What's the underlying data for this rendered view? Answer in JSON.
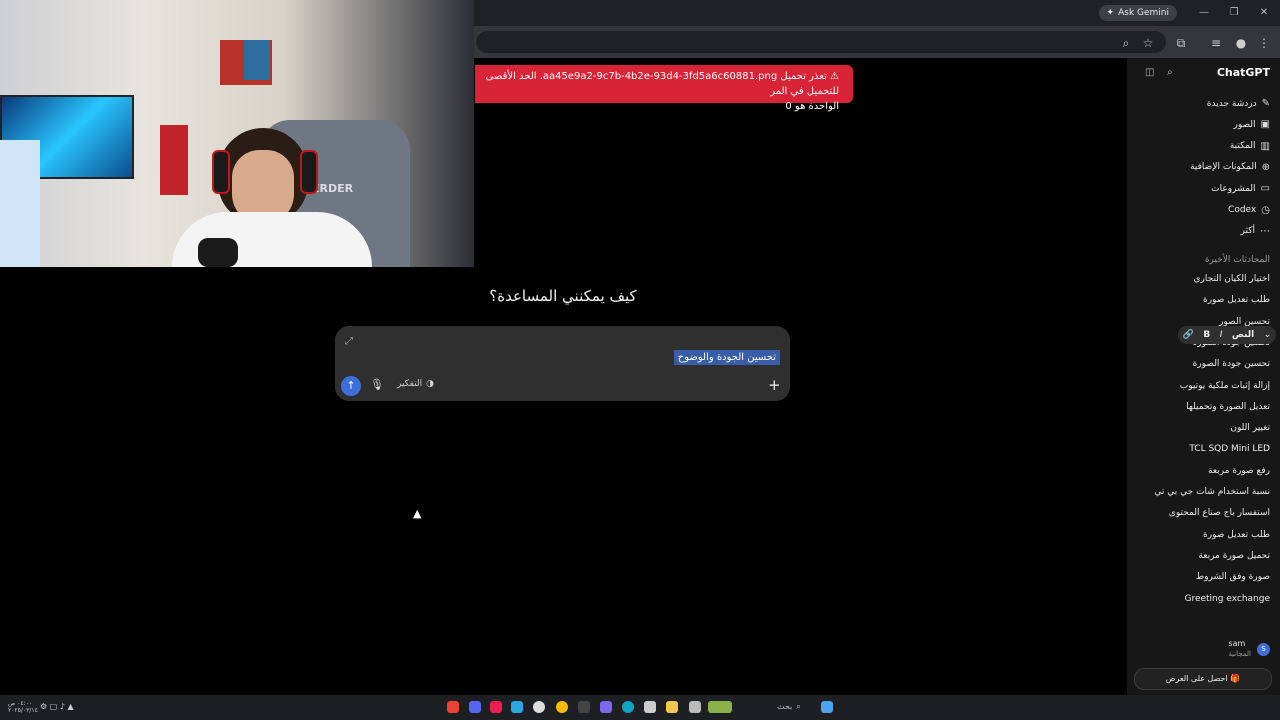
{
  "browser": {
    "ask_gemini_label": "Ask Gemini"
  },
  "error_toast": {
    "line1": "تعذر تحميل aa45e9a2-9c7b-4b2e-93d4-3fd5a6c60881.png. الحد الأقصى للتحميل في المر",
    "line2": "الواحدة هو 0",
    "color": "#d92336"
  },
  "main": {
    "greeting": "كيف يمكنني المساعدة؟",
    "composer": {
      "selected_text": "تحسين الجودة والوضوح",
      "thinking_label": "التفكير"
    }
  },
  "sidebar": {
    "app_title": "ChatGPT",
    "nav": [
      {
        "label": "دردشة جديدة",
        "icon": "edit-icon"
      },
      {
        "label": "الصور",
        "icon": "image-icon"
      },
      {
        "label": "المكتبة",
        "icon": "library-icon"
      },
      {
        "label": "المكونات الإضافية",
        "icon": "plugins-icon"
      },
      {
        "label": "المشروعات",
        "icon": "folder-icon"
      },
      {
        "label": "Codex",
        "icon": "codex-icon"
      },
      {
        "label": "أكثر",
        "icon": "more-icon"
      }
    ],
    "recent_heading": "المحادثات الأخيرة",
    "chats": [
      "اختيار الكيان التجاري",
      "طلب تعديل صورة",
      "تحسين الصور",
      "تحسين جودة الصورة",
      "تحسين جودة الصورة",
      "إزالة إثبات ملكية يوتيوب",
      "تعديل الصورة وتحميلها",
      "تغيير اللون",
      "TCL SQD Mini LED",
      "رفع صورة مربعة",
      "نسبة استخدام شات جي بي تي",
      "استفسار باج صناع المحتوى",
      "طلب تعديل صورة",
      "تحميل صورة مربعة",
      "صورة وفق الشروط",
      "Greeting exchange"
    ],
    "format_bar": {
      "text_label": "النص",
      "bold": "B",
      "italic": "I"
    },
    "user": {
      "name": "sam",
      "plan": "المجانية",
      "initial": "S"
    },
    "upgrade_label": "احصل على العرض"
  },
  "taskbar": {
    "search_label": "بحث",
    "clock_time": "٠٤:٠٠ ص",
    "clock_date": "٢٠٢٥/٠٣/١٤"
  },
  "colors": {
    "accent": "#3e6fd8",
    "sidebar_bg": "#171717",
    "composer_bg": "#2f2f2f"
  }
}
